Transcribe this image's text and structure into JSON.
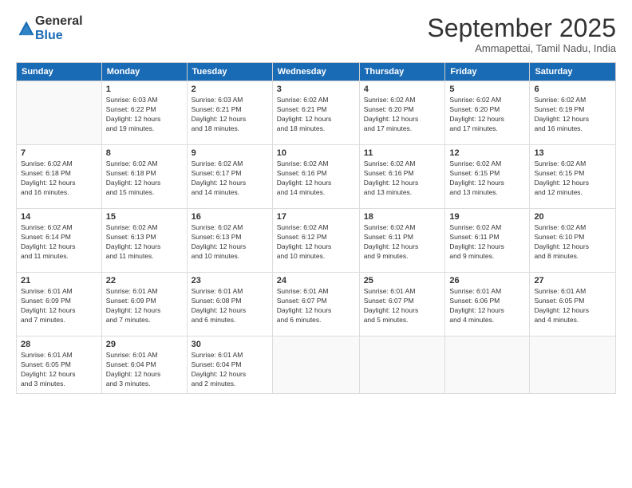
{
  "logo": {
    "general": "General",
    "blue": "Blue"
  },
  "title": "September 2025",
  "subtitle": "Ammapettai, Tamil Nadu, India",
  "headers": [
    "Sunday",
    "Monday",
    "Tuesday",
    "Wednesday",
    "Thursday",
    "Friday",
    "Saturday"
  ],
  "weeks": [
    [
      {
        "day": "",
        "info": ""
      },
      {
        "day": "1",
        "info": "Sunrise: 6:03 AM\nSunset: 6:22 PM\nDaylight: 12 hours\nand 19 minutes."
      },
      {
        "day": "2",
        "info": "Sunrise: 6:03 AM\nSunset: 6:21 PM\nDaylight: 12 hours\nand 18 minutes."
      },
      {
        "day": "3",
        "info": "Sunrise: 6:02 AM\nSunset: 6:21 PM\nDaylight: 12 hours\nand 18 minutes."
      },
      {
        "day": "4",
        "info": "Sunrise: 6:02 AM\nSunset: 6:20 PM\nDaylight: 12 hours\nand 17 minutes."
      },
      {
        "day": "5",
        "info": "Sunrise: 6:02 AM\nSunset: 6:20 PM\nDaylight: 12 hours\nand 17 minutes."
      },
      {
        "day": "6",
        "info": "Sunrise: 6:02 AM\nSunset: 6:19 PM\nDaylight: 12 hours\nand 16 minutes."
      }
    ],
    [
      {
        "day": "7",
        "info": "Sunrise: 6:02 AM\nSunset: 6:18 PM\nDaylight: 12 hours\nand 16 minutes."
      },
      {
        "day": "8",
        "info": "Sunrise: 6:02 AM\nSunset: 6:18 PM\nDaylight: 12 hours\nand 15 minutes."
      },
      {
        "day": "9",
        "info": "Sunrise: 6:02 AM\nSunset: 6:17 PM\nDaylight: 12 hours\nand 14 minutes."
      },
      {
        "day": "10",
        "info": "Sunrise: 6:02 AM\nSunset: 6:16 PM\nDaylight: 12 hours\nand 14 minutes."
      },
      {
        "day": "11",
        "info": "Sunrise: 6:02 AM\nSunset: 6:16 PM\nDaylight: 12 hours\nand 13 minutes."
      },
      {
        "day": "12",
        "info": "Sunrise: 6:02 AM\nSunset: 6:15 PM\nDaylight: 12 hours\nand 13 minutes."
      },
      {
        "day": "13",
        "info": "Sunrise: 6:02 AM\nSunset: 6:15 PM\nDaylight: 12 hours\nand 12 minutes."
      }
    ],
    [
      {
        "day": "14",
        "info": "Sunrise: 6:02 AM\nSunset: 6:14 PM\nDaylight: 12 hours\nand 11 minutes."
      },
      {
        "day": "15",
        "info": "Sunrise: 6:02 AM\nSunset: 6:13 PM\nDaylight: 12 hours\nand 11 minutes."
      },
      {
        "day": "16",
        "info": "Sunrise: 6:02 AM\nSunset: 6:13 PM\nDaylight: 12 hours\nand 10 minutes."
      },
      {
        "day": "17",
        "info": "Sunrise: 6:02 AM\nSunset: 6:12 PM\nDaylight: 12 hours\nand 10 minutes."
      },
      {
        "day": "18",
        "info": "Sunrise: 6:02 AM\nSunset: 6:11 PM\nDaylight: 12 hours\nand 9 minutes."
      },
      {
        "day": "19",
        "info": "Sunrise: 6:02 AM\nSunset: 6:11 PM\nDaylight: 12 hours\nand 9 minutes."
      },
      {
        "day": "20",
        "info": "Sunrise: 6:02 AM\nSunset: 6:10 PM\nDaylight: 12 hours\nand 8 minutes."
      }
    ],
    [
      {
        "day": "21",
        "info": "Sunrise: 6:01 AM\nSunset: 6:09 PM\nDaylight: 12 hours\nand 7 minutes."
      },
      {
        "day": "22",
        "info": "Sunrise: 6:01 AM\nSunset: 6:09 PM\nDaylight: 12 hours\nand 7 minutes."
      },
      {
        "day": "23",
        "info": "Sunrise: 6:01 AM\nSunset: 6:08 PM\nDaylight: 12 hours\nand 6 minutes."
      },
      {
        "day": "24",
        "info": "Sunrise: 6:01 AM\nSunset: 6:07 PM\nDaylight: 12 hours\nand 6 minutes."
      },
      {
        "day": "25",
        "info": "Sunrise: 6:01 AM\nSunset: 6:07 PM\nDaylight: 12 hours\nand 5 minutes."
      },
      {
        "day": "26",
        "info": "Sunrise: 6:01 AM\nSunset: 6:06 PM\nDaylight: 12 hours\nand 4 minutes."
      },
      {
        "day": "27",
        "info": "Sunrise: 6:01 AM\nSunset: 6:05 PM\nDaylight: 12 hours\nand 4 minutes."
      }
    ],
    [
      {
        "day": "28",
        "info": "Sunrise: 6:01 AM\nSunset: 6:05 PM\nDaylight: 12 hours\nand 3 minutes."
      },
      {
        "day": "29",
        "info": "Sunrise: 6:01 AM\nSunset: 6:04 PM\nDaylight: 12 hours\nand 3 minutes."
      },
      {
        "day": "30",
        "info": "Sunrise: 6:01 AM\nSunset: 6:04 PM\nDaylight: 12 hours\nand 2 minutes."
      },
      {
        "day": "",
        "info": ""
      },
      {
        "day": "",
        "info": ""
      },
      {
        "day": "",
        "info": ""
      },
      {
        "day": "",
        "info": ""
      }
    ]
  ]
}
